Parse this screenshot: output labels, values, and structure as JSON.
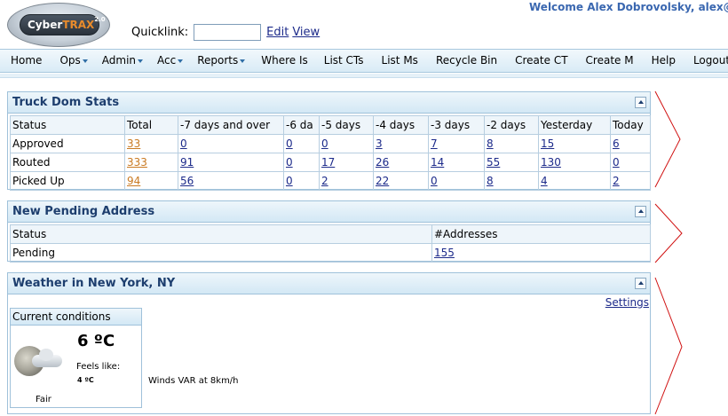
{
  "header": {
    "logo": {
      "brand_prefix": "Cyber",
      "brand_suffix": "TRAX",
      "version": "2.0"
    },
    "quicklink_label": "Quicklink:",
    "quicklink_value": "",
    "edit_link": "Edit",
    "view_link": "View",
    "welcome": "Welcome Alex Dobrovolsky, alex@j"
  },
  "nav": {
    "items": [
      {
        "label": "Home",
        "dropdown": false
      },
      {
        "label": "Ops",
        "dropdown": true
      },
      {
        "label": "Admin",
        "dropdown": true
      },
      {
        "label": "Acc",
        "dropdown": true
      },
      {
        "label": "Reports",
        "dropdown": true
      },
      {
        "label": "Where Is",
        "dropdown": false
      },
      {
        "label": "List CTs",
        "dropdown": false
      },
      {
        "label": "List Ms",
        "dropdown": false
      },
      {
        "label": "Recycle Bin",
        "dropdown": false
      },
      {
        "label": "Create CT",
        "dropdown": false
      },
      {
        "label": "Create M",
        "dropdown": false
      },
      {
        "label": "Help",
        "dropdown": false
      },
      {
        "label": "Logout",
        "dropdown": false
      }
    ]
  },
  "truck_dom": {
    "title": "Truck Dom Stats",
    "columns": [
      "Status",
      "Total",
      "-7 days and over",
      "-6 da",
      "-5 days",
      "-4 days",
      "-3 days",
      "-2 days",
      "Yesterday",
      "Today"
    ],
    "rows": [
      {
        "status": "Approved",
        "cells": [
          "33",
          "0",
          "0",
          "0",
          "3",
          "7",
          "8",
          "15",
          "6"
        ]
      },
      {
        "status": "Routed",
        "cells": [
          "333",
          "91",
          "0",
          "17",
          "26",
          "14",
          "55",
          "130",
          "0"
        ]
      },
      {
        "status": "Picked Up",
        "cells": [
          "94",
          "56",
          "0",
          "2",
          "22",
          "0",
          "8",
          "4",
          "2"
        ]
      }
    ]
  },
  "pending_address": {
    "title": "New Pending Address",
    "columns": [
      "Status",
      "#Addresses"
    ],
    "rows": [
      {
        "status": "Pending",
        "count": "155"
      }
    ]
  },
  "weather": {
    "title": "Weather in New York, NY",
    "settings": "Settings",
    "current_label": "Current conditions",
    "temperature": "6 ºC",
    "feels_like_label": "Feels like:",
    "feels_like_value": "4 ºC",
    "condition": "Fair",
    "winds": "Winds VAR at 8km/h"
  },
  "colors": {
    "accent": "#3a67b0",
    "link": "#1c2a8a",
    "link_total": "#c97a22",
    "annotation": "#d01010"
  }
}
